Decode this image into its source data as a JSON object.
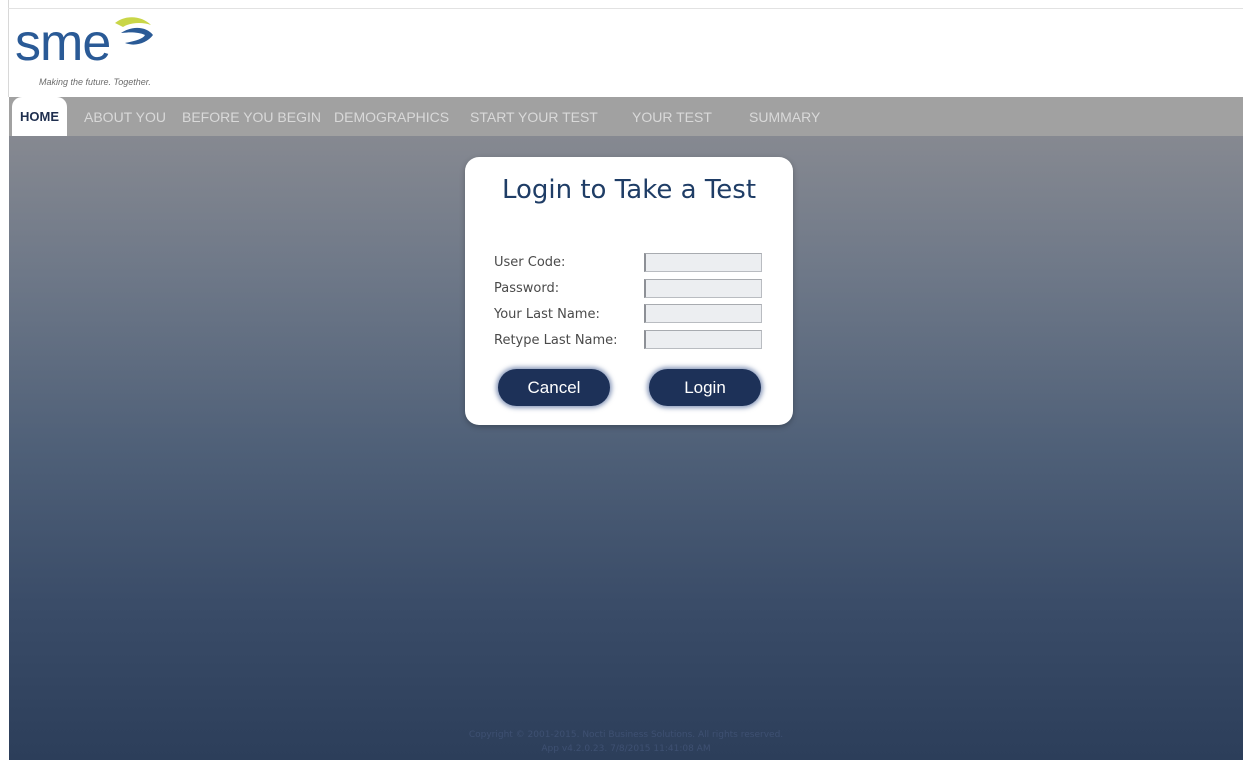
{
  "logo": {
    "wordmark": "sme",
    "tagline": "Making the future. Together.",
    "colors": {
      "wordmark": "#2a5a96",
      "swoosh_yellow": "#c9d648",
      "swoosh_blue": "#2a5a96"
    }
  },
  "nav": {
    "items": [
      {
        "label": "HOME",
        "active": true
      },
      {
        "label": "ABOUT YOU",
        "active": false
      },
      {
        "label": "BEFORE YOU BEGIN",
        "active": false
      },
      {
        "label": "DEMOGRAPHICS",
        "active": false
      },
      {
        "label": "START YOUR TEST",
        "active": false
      },
      {
        "label": "YOUR TEST",
        "active": false
      },
      {
        "label": "SUMMARY",
        "active": false
      }
    ]
  },
  "login": {
    "title": "Login to Take a Test",
    "fields": [
      {
        "label": "User Code:",
        "value": "",
        "placeholder": ""
      },
      {
        "label": "Password:",
        "value": "",
        "placeholder": ""
      },
      {
        "label": "Your Last Name:",
        "value": "",
        "placeholder": ""
      },
      {
        "label": "Retype Last Name:",
        "value": "",
        "placeholder": ""
      }
    ],
    "cancel_label": "Cancel",
    "login_label": "Login"
  },
  "footer": {
    "copyright": "Copyright © 2001-2015. Nocti Business Solutions. All rights reserved.",
    "version": "App v4.2.0.23. 7/8/2015 11:41:08 AM"
  },
  "colors": {
    "nav_bg": "#a1a1a1",
    "button_bg": "#1d3158",
    "title_color": "#1f3d66",
    "gradient_top": "#868991",
    "gradient_bottom": "#2c3e5a"
  }
}
